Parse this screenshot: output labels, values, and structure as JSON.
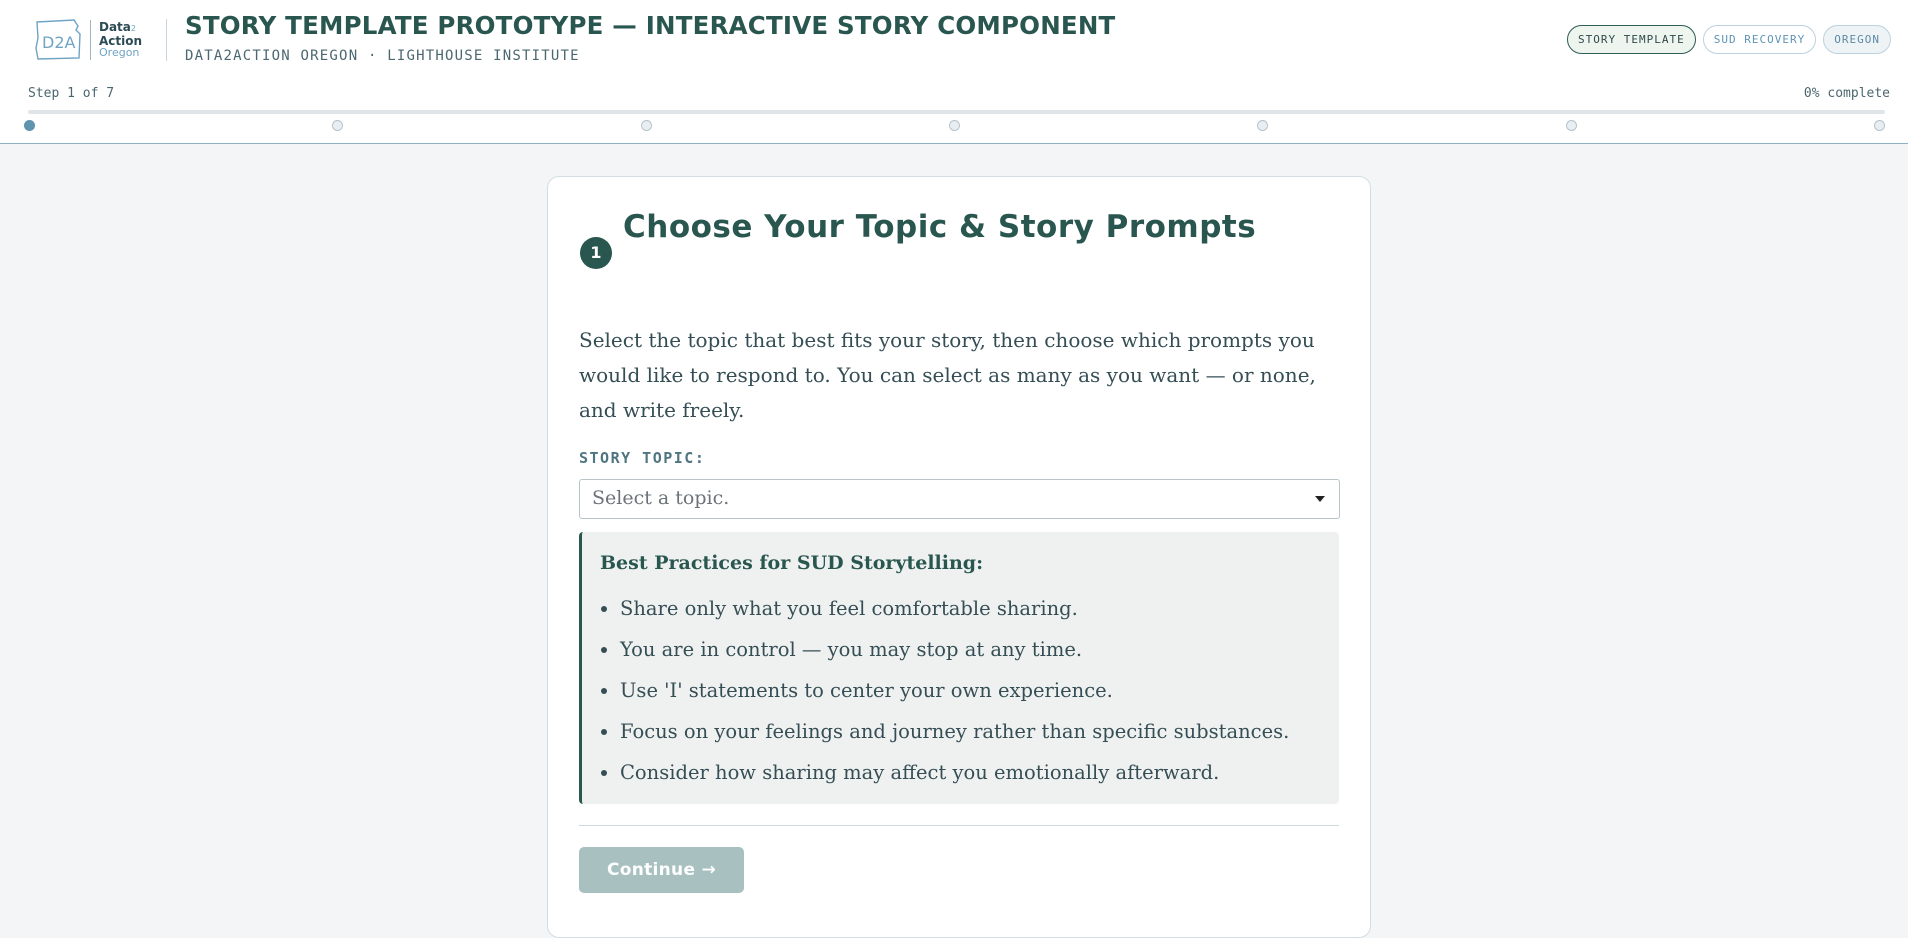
{
  "header": {
    "logo": {
      "mark": "D2A",
      "line1": "Data",
      "line1_sup": "2",
      "line2": "Action",
      "line3": "Oregon"
    },
    "title": "STORY TEMPLATE PROTOTYPE — INTERACTIVE STORY COMPONENT",
    "subtitle": "DATA2ACTION OREGON · LIGHTHOUSE INSTITUTE",
    "tags": [
      "STORY TEMPLATE",
      "SUD RECOVERY",
      "OREGON"
    ]
  },
  "progress": {
    "step_label": "Step 1 of 7",
    "percent_label": "0% complete",
    "current_step": 1,
    "total_steps": 7,
    "percent": 0
  },
  "card": {
    "step_number": "1",
    "title": "Choose Your Topic & Story Prompts",
    "intro": "Select the topic that best fits your story, then choose which prompts you would like to respond to. You can select as many as you want — or none, and write freely.",
    "topic_label": "STORY TOPIC:",
    "topic_placeholder": "Select a topic.",
    "practices": {
      "title": "Best Practices for SUD Storytelling:",
      "items": [
        "Share only what you feel comfortable sharing.",
        "You are in control — you may stop at any time.",
        "Use 'I' statements to center your own experience.",
        "Focus on your feelings and journey rather than specific substances.",
        "Consider how sharing may affect you emotionally afterward."
      ]
    },
    "continue_label": "Continue →"
  },
  "colors": {
    "brand": "#2a5650",
    "accent": "#5f93ae",
    "disabled_button": "#a8c0c0",
    "page_bg": "#f3f5f6"
  },
  "icons": {
    "logo": "oregon-outline-icon",
    "select": "caret-down-icon"
  }
}
